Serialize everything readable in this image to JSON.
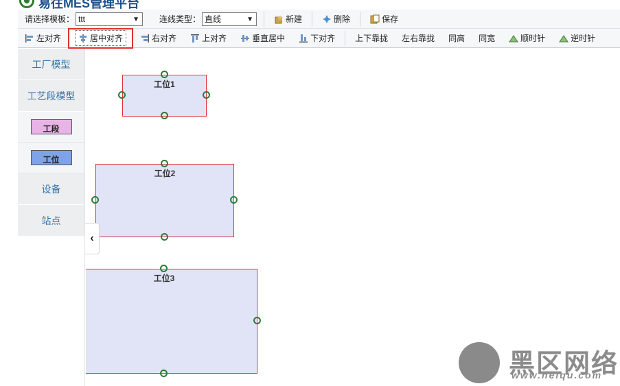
{
  "app": {
    "title": "易往MES管理平台"
  },
  "toolbar1": {
    "template_label": "请选择模板：",
    "template_value": "ttt",
    "line_type_label": "连线类型：",
    "line_type_value": "直线",
    "new_label": "新建",
    "delete_label": "删除",
    "save_label": "保存"
  },
  "toolbar2": {
    "items": [
      {
        "label": "左对齐",
        "icon": "align-left-icon"
      },
      {
        "label": "居中对齐",
        "icon": "align-center-icon",
        "active": true
      },
      {
        "label": "右对齐",
        "icon": "align-right-icon"
      },
      {
        "label": "上对齐",
        "icon": "align-top-icon"
      },
      {
        "label": "垂直居中",
        "icon": "align-middle-icon"
      },
      {
        "label": "下对齐",
        "icon": "align-bottom-icon"
      },
      {
        "label": "上下靠拢"
      },
      {
        "label": "左右靠拢"
      },
      {
        "label": "同高"
      },
      {
        "label": "同宽"
      },
      {
        "label": "顺时针",
        "icon": "rotate-cw-icon"
      },
      {
        "label": "逆时针",
        "icon": "rotate-ccw-icon"
      }
    ]
  },
  "sidebar": {
    "factory_model": "工厂模型",
    "process_model": "工艺段模型",
    "segment_shape": "工段",
    "station_shape": "工位",
    "equipment": "设备",
    "site": "站点"
  },
  "canvas": {
    "stations": [
      {
        "label": "工位1"
      },
      {
        "label": "工位2"
      },
      {
        "label": "工位3"
      }
    ]
  },
  "colors": {
    "accent_red": "#e0302c",
    "station_fill": "#e1e4f7",
    "anchor_green": "#2f7a3a",
    "segment_fill": "#e8b4e6",
    "station_shape_fill": "#7ea3ea"
  },
  "watermark": {
    "cn": "黑区网络",
    "url": "www.heiqu.com"
  }
}
